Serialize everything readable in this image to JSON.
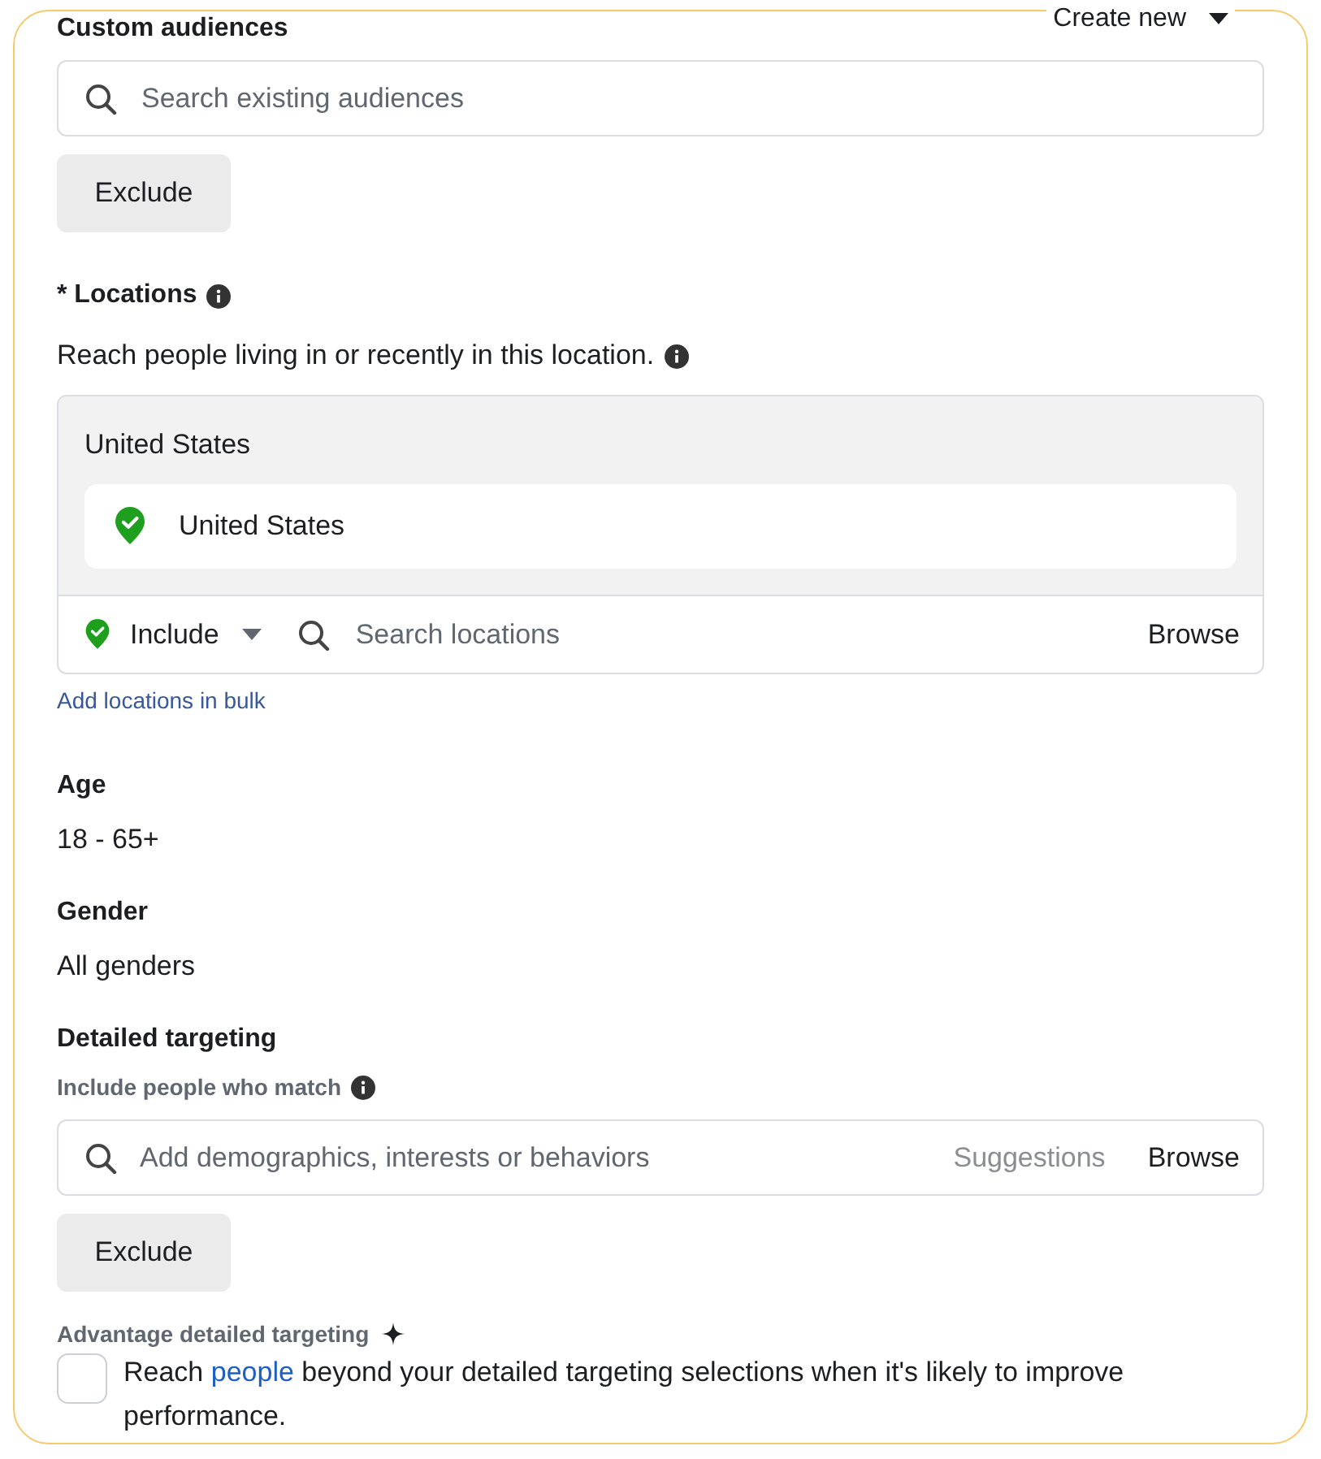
{
  "custom_audiences": {
    "title": "Custom audiences",
    "create_new": "Create new",
    "search": {
      "placeholder": "Search existing audiences"
    },
    "exclude_button": "Exclude"
  },
  "locations": {
    "title": "* Locations",
    "description": "Reach people living in or recently in this location.",
    "group_title": "United States",
    "selected": [
      {
        "name": "United States",
        "included": true
      }
    ],
    "mode": {
      "label": "Include",
      "included": true
    },
    "search": {
      "placeholder": "Search locations"
    },
    "browse": "Browse",
    "bulk_link": "Add locations in bulk"
  },
  "age": {
    "title": "Age",
    "value": "18 - 65+"
  },
  "gender": {
    "title": "Gender",
    "value": "All genders"
  },
  "detailed_targeting": {
    "title": "Detailed targeting",
    "subtitle": "Include people who match",
    "search": {
      "placeholder": "Add demographics, interests or behaviors"
    },
    "suggestions": "Suggestions",
    "browse": "Browse",
    "exclude_button": "Exclude"
  },
  "advantage": {
    "title": "Advantage detailed targeting",
    "checked": false,
    "text_before": "Reach",
    "link": "people",
    "text_after": "beyond your detailed targeting selections when it's likely to improve performance."
  }
}
